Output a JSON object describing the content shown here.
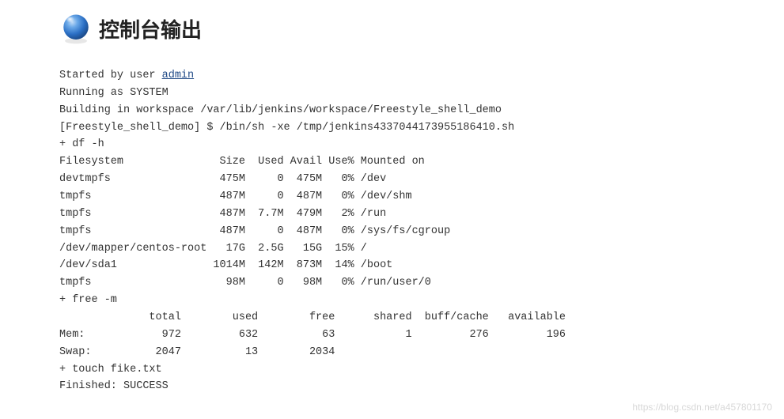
{
  "header": {
    "title": "控制台输出",
    "icon_name": "blue-ball-icon"
  },
  "console": {
    "prefix": "Started by user ",
    "user_link": "admin",
    "lines": "Running as SYSTEM\nBuilding in workspace /var/lib/jenkins/workspace/Freestyle_shell_demo\n[Freestyle_shell_demo] $ /bin/sh -xe /tmp/jenkins4337044173955186410.sh\n+ df -h\nFilesystem               Size  Used Avail Use% Mounted on\ndevtmpfs                 475M     0  475M   0% /dev\ntmpfs                    487M     0  487M   0% /dev/shm\ntmpfs                    487M  7.7M  479M   2% /run\ntmpfs                    487M     0  487M   0% /sys/fs/cgroup\n/dev/mapper/centos-root   17G  2.5G   15G  15% /\n/dev/sda1               1014M  142M  873M  14% /boot\ntmpfs                     98M     0   98M   0% /run/user/0\n+ free -m\n              total        used        free      shared  buff/cache   available\nMem:            972         632          63           1         276         196\nSwap:          2047          13        2034\n+ touch fike.txt\nFinished: SUCCESS"
  },
  "watermark": "https://blog.csdn.net/a457801170"
}
